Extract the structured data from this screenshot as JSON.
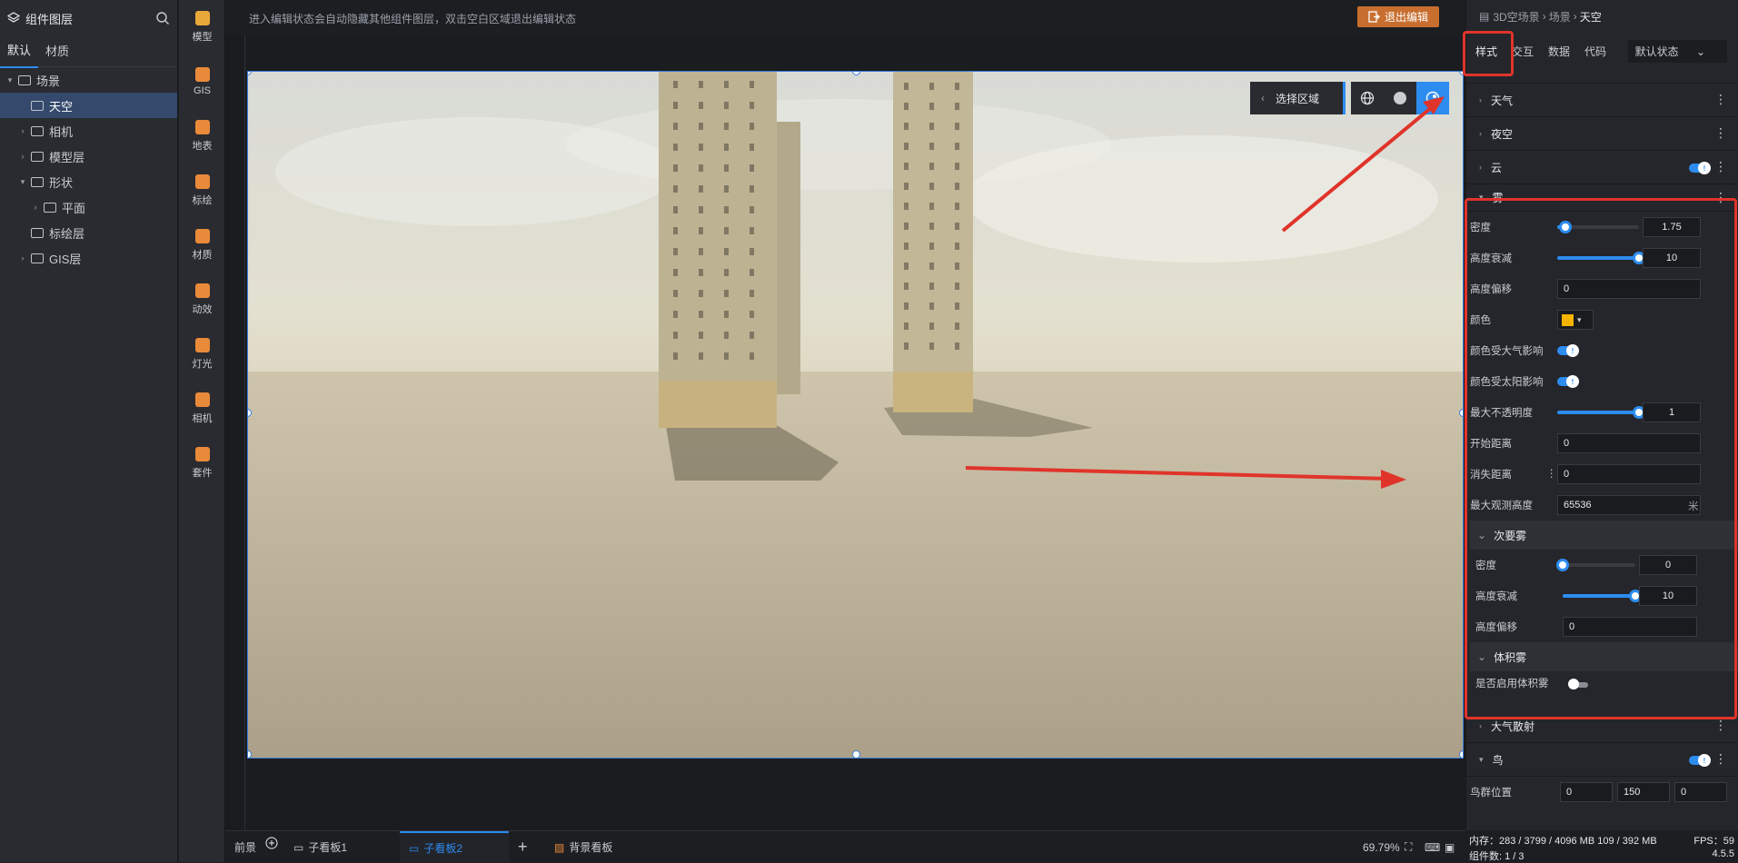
{
  "tree": {
    "title": "组件图层",
    "tabs": [
      "默认",
      "材质"
    ],
    "nodes": [
      {
        "label": "场景",
        "caret": "▾",
        "indent": 0
      },
      {
        "label": "天空",
        "caret": "",
        "indent": 1,
        "selected": true
      },
      {
        "label": "相机",
        "caret": "›",
        "indent": 1
      },
      {
        "label": "模型层",
        "caret": "›",
        "indent": 1
      },
      {
        "label": "形状",
        "caret": "▾",
        "indent": 1
      },
      {
        "label": "平面",
        "caret": "›",
        "indent": 2
      },
      {
        "label": "标绘层",
        "caret": "",
        "indent": 1
      },
      {
        "label": "GIS层",
        "caret": "›",
        "indent": 1
      }
    ]
  },
  "icon_column": [
    {
      "label": "模型",
      "icon": "model-icon",
      "color": "#e9a93a"
    },
    {
      "label": "GIS",
      "icon": "globe-icon",
      "color": "#e98a3a"
    },
    {
      "label": "地表",
      "icon": "terrain-icon",
      "color": "#e98a3a"
    },
    {
      "label": "标绘",
      "icon": "pin-icon",
      "color": "#e98a3a"
    },
    {
      "label": "材质",
      "icon": "material-icon",
      "color": "#e98a3a"
    },
    {
      "label": "动效",
      "icon": "effect-icon",
      "color": "#e98a3a"
    },
    {
      "label": "灯光",
      "icon": "light-icon",
      "color": "#e98a3a"
    },
    {
      "label": "相机",
      "icon": "camera-icon",
      "color": "#e98a3a"
    },
    {
      "label": "套件",
      "icon": "kit-icon",
      "color": "#e98a3a"
    }
  ],
  "topbar": {
    "message": "进入编辑状态会自动隐藏其他组件图层，双击空白区域退出编辑状态",
    "exit_label": "退出编辑"
  },
  "viewport_toolbar": {
    "select_label": "选择区域"
  },
  "bottom": {
    "tabs": [
      "前景",
      "子看板1",
      "子看板2",
      "背景看板"
    ],
    "zoom": "69.79%"
  },
  "right_panel": {
    "breadcrumb": [
      "3D空场景",
      "场景",
      "天空"
    ],
    "tabs": [
      "样式",
      "交互",
      "数据",
      "代码"
    ],
    "state": "默认状态",
    "sections_top": [
      "天气",
      "夜空",
      "云"
    ],
    "fog_title": "雾",
    "fog": {
      "density_label": "密度",
      "density": "1.75",
      "density_level": 0.1,
      "height_falloff_label": "高度衰减",
      "height_falloff": "10",
      "height_falloff_level": 1.0,
      "height_offset_label": "高度偏移",
      "height_offset": "0",
      "color_label": "颜色",
      "color": "#f5b400",
      "atm_label": "颜色受大气影响",
      "sun_label": "颜色受太阳影响",
      "max_opacity_label": "最大不透明度",
      "max_opacity": "1",
      "max_opacity_level": 1.0,
      "start_label": "开始距离",
      "start": "0",
      "cutoff_label": "消失距离",
      "cutoff": "0",
      "max_height_label": "最大观测高度",
      "max_height": "65536",
      "max_height_unit": "米"
    },
    "secondary_title": "次要雾",
    "secondary": {
      "density_label": "密度",
      "density": "0",
      "density_level": 0.0,
      "height_falloff_label": "高度衰减",
      "height_falloff": "10",
      "height_falloff_level": 1.0,
      "height_offset_label": "高度偏移",
      "height_offset": "0"
    },
    "volume_title": "体积雾",
    "volume_enable_label": "是否启用体积雾",
    "atmosphere_title": "大气散射",
    "birds_title": "鸟",
    "birds_position_label": "鸟群位置",
    "birds_position": [
      "0",
      "150",
      "0"
    ]
  },
  "status": {
    "memory": "内存：283 / 3799 / 4096 MB  109 / 392 MB",
    "fps": "FPS：59",
    "count": "组件数: 1 / 3",
    "version": "4.5.5"
  }
}
